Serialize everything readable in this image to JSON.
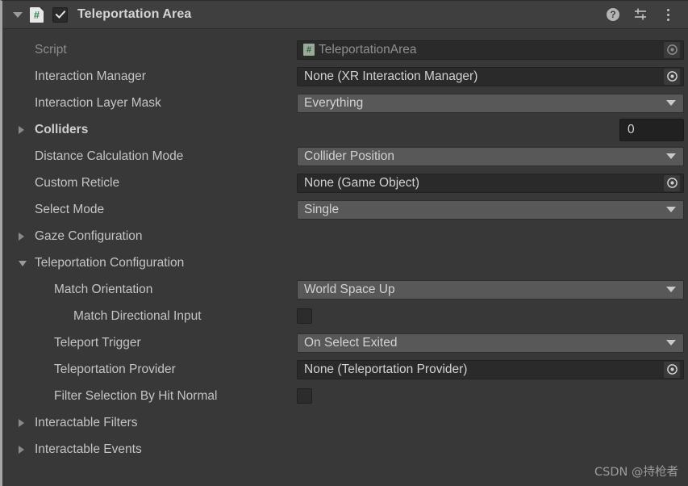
{
  "header": {
    "foldout_icon": "triangle-down-icon",
    "script_icon": "csharp-script-icon",
    "script_icon_glyph": "#",
    "enabled_checkbox": true,
    "title": "Teleportation Area",
    "help_label": "?",
    "help_icon": "help-icon",
    "preset_icon": "preset-settings-icon",
    "menu_icon": "kebab-menu-icon"
  },
  "rows": [
    {
      "label": "Script",
      "disabled": true,
      "control": "object",
      "value": "TeleportationArea",
      "value_icon": "csharp-script-icon",
      "value_icon_glyph": "#",
      "name": "script"
    },
    {
      "label": "Interaction Manager",
      "control": "object",
      "value": "None (XR Interaction Manager)",
      "name": "interaction-manager"
    },
    {
      "label": "Interaction Layer Mask",
      "control": "dropdown",
      "value": "Everything",
      "name": "interaction-layer-mask"
    },
    {
      "label": "Colliders",
      "control": "number",
      "value": "0",
      "foldout": "collapsed",
      "bold": true,
      "name": "colliders"
    },
    {
      "label": "Distance Calculation Mode",
      "control": "dropdown",
      "value": "Collider Position",
      "name": "distance-calculation-mode"
    },
    {
      "label": "Custom Reticle",
      "control": "object",
      "value": "None (Game Object)",
      "name": "custom-reticle"
    },
    {
      "label": "Select Mode",
      "control": "dropdown",
      "value": "Single",
      "name": "select-mode"
    },
    {
      "label": "Gaze Configuration",
      "control": "none",
      "foldout": "collapsed",
      "name": "gaze-configuration"
    },
    {
      "label": "Teleportation Configuration",
      "control": "none",
      "foldout": "expanded",
      "name": "teleportation-configuration"
    },
    {
      "label": "Match Orientation",
      "control": "dropdown",
      "value": "World Space Up",
      "indent": 1,
      "name": "match-orientation"
    },
    {
      "label": "Match Directional Input",
      "control": "checkbox",
      "checked": false,
      "indent": 2,
      "name": "match-directional-input"
    },
    {
      "label": "Teleport Trigger",
      "control": "dropdown",
      "value": "On Select Exited",
      "indent": 1,
      "name": "teleport-trigger"
    },
    {
      "label": "Teleportation Provider",
      "control": "object",
      "value": "None (Teleportation Provider)",
      "indent": 1,
      "name": "teleportation-provider"
    },
    {
      "label": "Filter Selection By Hit Normal",
      "control": "checkbox",
      "checked": false,
      "indent": 1,
      "name": "filter-selection-by-hit-normal"
    },
    {
      "label": "Interactable Filters",
      "control": "none",
      "foldout": "collapsed",
      "name": "interactable-filters"
    },
    {
      "label": "Interactable Events",
      "control": "none",
      "foldout": "collapsed",
      "name": "interactable-events"
    }
  ],
  "watermark": "CSDN @持枪者",
  "colors": {
    "panel_bg": "#383838",
    "header_bg": "#3f3f3f",
    "dropdown_bg": "#585858",
    "object_bg": "#2a2a2a",
    "text": "#c4c4c4",
    "text_dim": "#8d8d8d",
    "script_green": "#2f8a4e"
  }
}
